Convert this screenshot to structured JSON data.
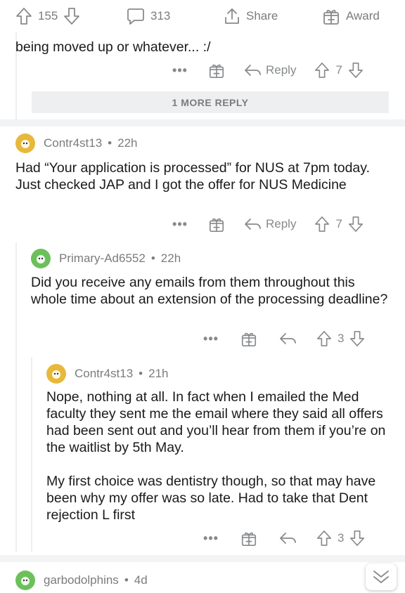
{
  "topbar": {
    "upvotes": "155",
    "comments": "313",
    "share_label": "Share",
    "award_label": "Award"
  },
  "comment0": {
    "text_tail": "being moved up or whatever... :/",
    "reply_label": "Reply",
    "score": "7"
  },
  "more_replies_label": "1 MORE REPLY",
  "comment1": {
    "author": "Contr4st13",
    "age": "22h",
    "text": "Had “Your application is processed” for NUS at 7pm today. Just checked JAP and I got the offer for NUS Medicine",
    "reply_label": "Reply",
    "score": "7"
  },
  "comment2": {
    "author": "Primary-Ad6552",
    "age": "22h",
    "text": "Did you receive any emails from them throughout this whole time about an extension of the processing deadline?",
    "score": "3"
  },
  "comment3": {
    "author": "Contr4st13",
    "age": "21h",
    "paragraph1": "Nope, nothing at all. In fact when I emailed the Med faculty they sent me the email where they said all offers had been sent out and you’ll hear from them if you’re on the waitlist by 5th May.",
    "paragraph2": "My first choice was dentistry though, so that may have been why my offer was so late. Had to take that Dent rejection L first",
    "score": "3"
  },
  "comment4": {
    "author": "garbodolphins",
    "age": "4d"
  },
  "separator_dot": "•",
  "more_dots": "•••",
  "colors": {
    "avatar_orange": "#e8b83a",
    "avatar_green": "#6cc05a",
    "meta_gray": "#7c7c7c",
    "bar_gray": "#edeff1"
  }
}
